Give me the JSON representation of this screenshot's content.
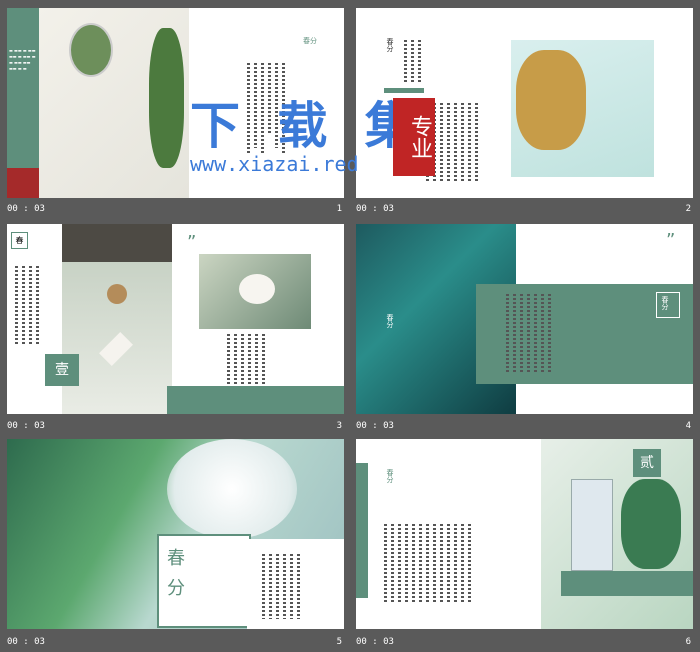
{
  "slides": [
    {
      "time": "00 : 03",
      "num": "1",
      "title": "春分"
    },
    {
      "time": "00 : 03",
      "num": "2",
      "title": "春分"
    },
    {
      "time": "00 : 03",
      "num": "3",
      "mark": "春",
      "badge": "壹"
    },
    {
      "time": "00 : 03",
      "num": "4",
      "title": "春分",
      "quote": "”"
    },
    {
      "time": "00 : 03",
      "num": "5",
      "title1": "春",
      "title2": "分"
    },
    {
      "time": "00 : 03",
      "num": "6",
      "title": "春分",
      "badge": "贰"
    }
  ],
  "watermark": {
    "main": "下 载 集",
    "url": "www.xiazai.red",
    "seal": "专业"
  },
  "colors": {
    "accent": "#5e8f7c",
    "seal": "#c02525",
    "watermark": "#3b7ad8"
  }
}
